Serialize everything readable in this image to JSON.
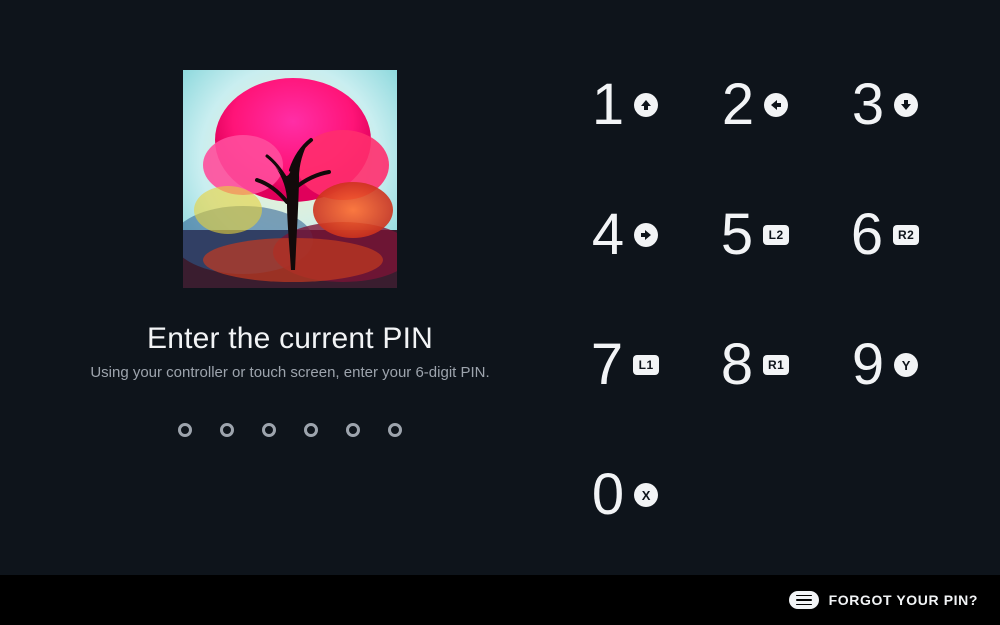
{
  "left": {
    "title": "Enter the current PIN",
    "subtitle": "Using your controller or touch screen, enter your 6-digit PIN.",
    "pin_length": 6,
    "entered": 0
  },
  "keypad": {
    "keys": [
      {
        "digit": "1",
        "hint_type": "arrow-up"
      },
      {
        "digit": "2",
        "hint_type": "arrow-left"
      },
      {
        "digit": "3",
        "hint_type": "arrow-down"
      },
      {
        "digit": "4",
        "hint_type": "arrow-right"
      },
      {
        "digit": "5",
        "hint_type": "badge",
        "hint_label": "L2"
      },
      {
        "digit": "6",
        "hint_type": "badge",
        "hint_label": "R2"
      },
      {
        "digit": "7",
        "hint_type": "badge",
        "hint_label": "L1"
      },
      {
        "digit": "8",
        "hint_type": "badge",
        "hint_label": "R1"
      },
      {
        "digit": "9",
        "hint_type": "letter",
        "hint_label": "Y"
      },
      {
        "digit": "0",
        "hint_type": "letter",
        "hint_label": "X"
      }
    ]
  },
  "footer": {
    "forgot_label": "FORGOT YOUR PIN?"
  }
}
